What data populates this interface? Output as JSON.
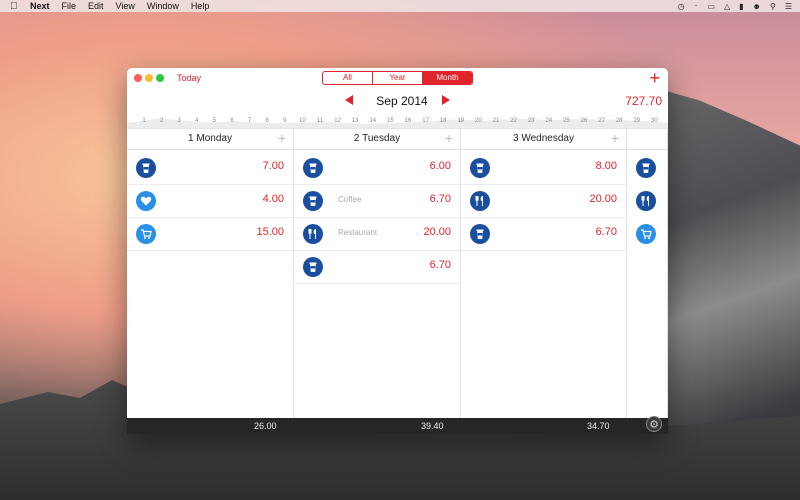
{
  "menubar": {
    "app": "Next",
    "items": [
      "File",
      "Edit",
      "View",
      "Window",
      "Help"
    ]
  },
  "window": {
    "today_label": "Today",
    "segments": [
      {
        "label": "All",
        "active": false
      },
      {
        "label": "Year",
        "active": false
      },
      {
        "label": "Month",
        "active": true
      }
    ],
    "add_label": "+",
    "month_title": "Sep 2014",
    "month_total": "727.70",
    "timeline_ticks": [
      "1",
      "2",
      "3",
      "4",
      "5",
      "6",
      "7",
      "8",
      "9",
      "10",
      "11",
      "12",
      "13",
      "14",
      "15",
      "16",
      "17",
      "18",
      "19",
      "20",
      "21",
      "22",
      "23",
      "24",
      "25",
      "26",
      "27",
      "28",
      "29",
      "30"
    ]
  },
  "days": [
    {
      "title": "1 Monday",
      "entries": [
        {
          "icon": "cup-icon",
          "shade": "dark",
          "note": "",
          "amount": "7.00"
        },
        {
          "icon": "heart-icon",
          "shade": "light",
          "note": "",
          "amount": "4.00"
        },
        {
          "icon": "cart-icon",
          "shade": "light",
          "note": "",
          "amount": "15.00"
        }
      ],
      "total": "26.00"
    },
    {
      "title": "2 Tuesday",
      "entries": [
        {
          "icon": "cup-icon",
          "shade": "dark",
          "note": "",
          "amount": "6.00"
        },
        {
          "icon": "cup-icon",
          "shade": "dark",
          "note": "Coffee",
          "amount": "6.70"
        },
        {
          "icon": "restaurant-icon",
          "shade": "dark",
          "note": "Restaurant",
          "amount": "20.00"
        },
        {
          "icon": "cup-icon",
          "shade": "dark",
          "note": "",
          "amount": "6.70"
        }
      ],
      "total": "39.40"
    },
    {
      "title": "3 Wednesday",
      "entries": [
        {
          "icon": "cup-icon",
          "shade": "dark",
          "note": "",
          "amount": "8.00"
        },
        {
          "icon": "restaurant-icon",
          "shade": "dark",
          "note": "",
          "amount": "20.00"
        },
        {
          "icon": "cup-icon",
          "shade": "dark",
          "note": "",
          "amount": "6.70"
        }
      ],
      "total": "34.70"
    },
    {
      "title": "",
      "entries": [
        {
          "icon": "cup-icon",
          "shade": "dark",
          "note": "",
          "amount": ""
        },
        {
          "icon": "restaurant-icon",
          "shade": "dark",
          "note": "",
          "amount": ""
        },
        {
          "icon": "cart-icon",
          "shade": "light",
          "note": "",
          "amount": ""
        }
      ],
      "total": ""
    }
  ],
  "colors": {
    "accent": "#e0242b",
    "icon_dark": "#1a4fa0",
    "icon_light": "#2a8fe6"
  }
}
